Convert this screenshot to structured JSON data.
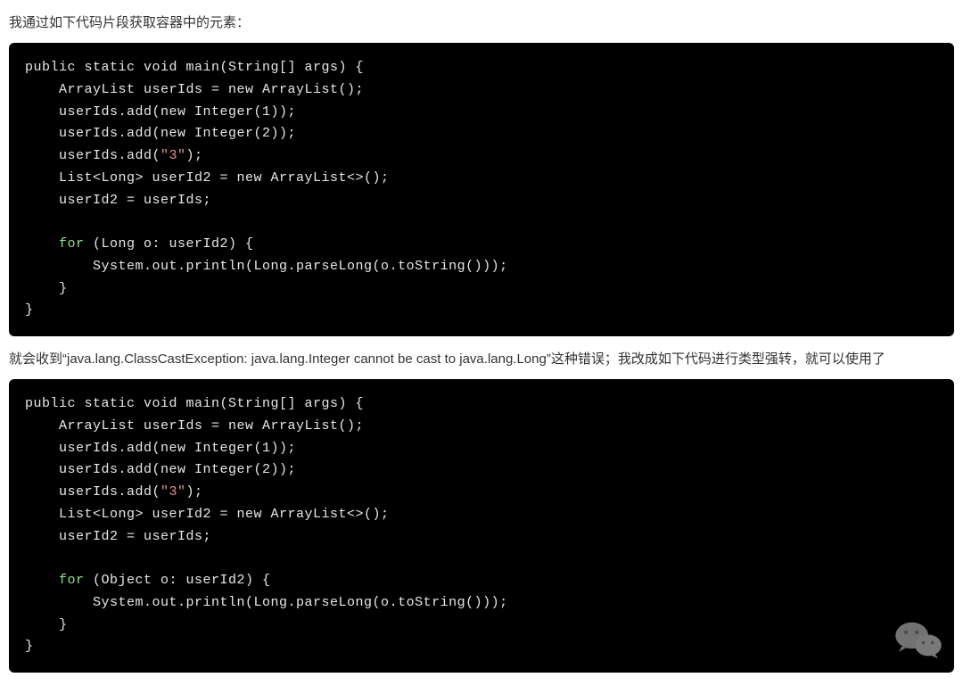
{
  "para1": "我通过如下代码片段获取容器中的元素：",
  "code1": {
    "l1": "public static void main(String[] args) {",
    "l2": "    ArrayList userIds = new ArrayList();",
    "l3": "    userIds.add(new Integer(1));",
    "l4": "    userIds.add(new Integer(2));",
    "l5a": "    userIds.add(",
    "l5s": "\"3\"",
    "l5b": ");",
    "l6": "    List<Long> userId2 = new ArrayList<>();",
    "l7": "    userId2 = userIds;",
    "l8": "",
    "l9a": "    ",
    "l9k": "for",
    "l9b": " (Long o: userId2) {",
    "l10": "        System.out.println(Long.parseLong(o.toString()));",
    "l11": "    }",
    "l12": "}"
  },
  "para2": "就会收到“java.lang.ClassCastException: java.lang.Integer cannot be cast to java.lang.Long”这种错误；我改成如下代码进行类型强转，就可以使用了",
  "code2": {
    "l1": "public static void main(String[] args) {",
    "l2": "    ArrayList userIds = new ArrayList();",
    "l3": "    userIds.add(new Integer(1));",
    "l4": "    userIds.add(new Integer(2));",
    "l5a": "    userIds.add(",
    "l5s": "\"3\"",
    "l5b": ");",
    "l6": "    List<Long> userId2 = new ArrayList<>();",
    "l7": "    userId2 = userIds;",
    "l8": "",
    "l9a": "    ",
    "l9k": "for",
    "l9b": " (Object o: userId2) {",
    "l10": "        System.out.println(Long.parseLong(o.toString()));",
    "l11": "    }",
    "l12": "}"
  }
}
